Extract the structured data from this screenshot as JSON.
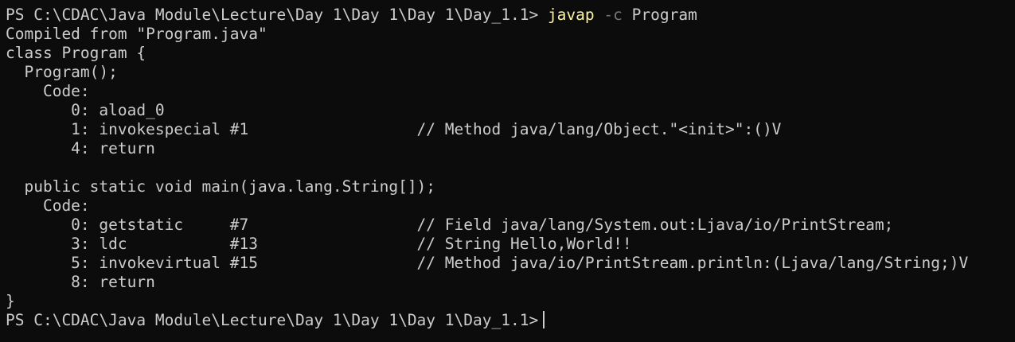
{
  "terminal": {
    "colors": {
      "background": "#0c0c0c",
      "foreground": "#cccccc",
      "command": "#f9f1a5",
      "flag": "#767676"
    },
    "prompt": "PS C:\\CDAC\\Java Module\\Lecture\\Day 1\\Day 1\\Day 1\\Day_1.1>",
    "command": {
      "program": "javap",
      "flag": "-c",
      "argument": "Program"
    },
    "output": [
      "Compiled from \"Program.java\"",
      "class Program {",
      "  Program();",
      "    Code:",
      "       0: aload_0",
      "       1: invokespecial #1                  // Method java/lang/Object.\"<init>\":()V",
      "       4: return",
      "",
      "  public static void main(java.lang.String[]);",
      "    Code:",
      "       0: getstatic     #7                  // Field java/lang/System.out:Ljava/io/PrintStream;",
      "       3: ldc           #13                 // String Hello,World!!",
      "       5: invokevirtual #15                 // Method java/io/PrintStream.println:(Ljava/lang/String;)V",
      "       8: return",
      "}"
    ]
  }
}
